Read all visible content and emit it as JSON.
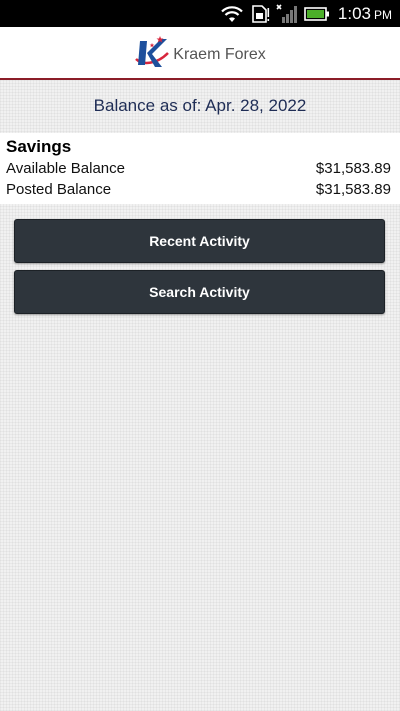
{
  "status_bar": {
    "time": "1:03",
    "ampm": "PM",
    "icons": [
      "wifi-icon",
      "sim-card-icon",
      "signal-icon",
      "battery-icon"
    ]
  },
  "header": {
    "brand_name": "Kraem Forex",
    "logo": "kraem-forex-logo",
    "accent_color": "#8b1d28"
  },
  "balance_date": "Balance as of: Apr. 28, 2022",
  "account": {
    "name": "Savings",
    "rows": [
      {
        "label": "Available Balance",
        "value": "$31,583.89"
      },
      {
        "label": "Posted Balance",
        "value": "$31,583.89"
      }
    ]
  },
  "actions": {
    "recent_label": "Recent Activity",
    "search_label": "Search Activity",
    "button_color": "#2e353c"
  }
}
